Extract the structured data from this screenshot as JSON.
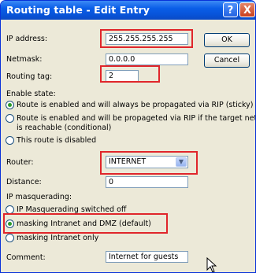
{
  "window": {
    "title": "Routing table - Edit Entry",
    "help": "?",
    "close": "X"
  },
  "buttons": {
    "ok": "OK",
    "cancel": "Cancel"
  },
  "fields": {
    "ip_label": "IP address:",
    "ip_value": "255.255.255.255",
    "netmask_label": "Netmask:",
    "netmask_value": "0.0.0.0",
    "tag_label": "Routing tag:",
    "tag_value": "2",
    "router_label": "Router:",
    "router_value": "INTERNET",
    "distance_label": "Distance:",
    "distance_value": "0",
    "comment_label": "Comment:",
    "comment_value": "Internet for guests"
  },
  "enable_state": {
    "label": "Enable state:",
    "options": [
      "Route is enabled and will always be propagated via RIP (sticky)",
      "Route is enabled and will be propageted via RIP if the target network",
      "is reachable (conditional)",
      "This route is disabled"
    ],
    "selected": 0
  },
  "masquerading": {
    "label": "IP masquerading:",
    "options": [
      "IP Masquerading switched off",
      "masking Intranet and DMZ (default)",
      "masking Intranet only"
    ],
    "selected": 1
  },
  "colors": {
    "highlight": "#e0262b",
    "titlebar": "#0a5ee8"
  }
}
